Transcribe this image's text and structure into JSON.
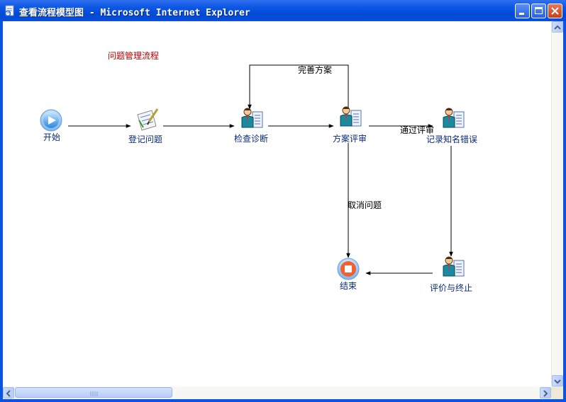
{
  "window": {
    "title": "查看流程模型图 - Microsoft Internet Explorer",
    "buttons": [
      "minimize",
      "maximize",
      "close"
    ]
  },
  "diagram": {
    "title": "问题管理流程",
    "nodes": {
      "start": "开始",
      "register": "登记问题",
      "diagnose": "检查诊断",
      "review": "方案评审",
      "record": "记录知名错误",
      "evaluate": "评价与终止",
      "end": "结束"
    },
    "edges": {
      "improve": "完善方案",
      "pass": "通过评审",
      "cancel": "取消问题"
    }
  },
  "colors": {
    "titlebar": "#0a54e0",
    "diagram_title": "#c00000",
    "node_label": "#0a2a7a"
  }
}
